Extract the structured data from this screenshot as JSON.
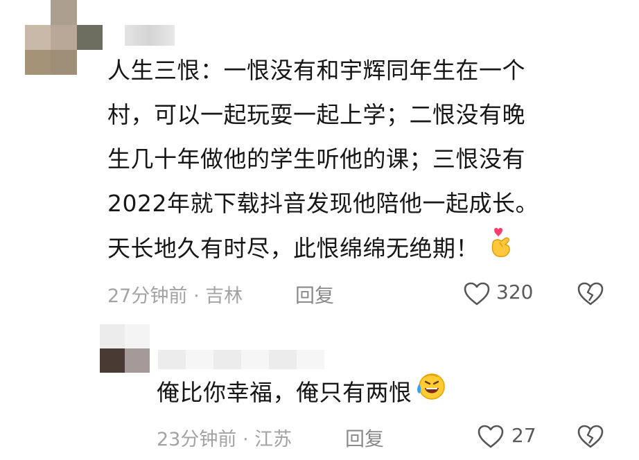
{
  "comments": [
    {
      "lines": [
        "人生三恨：一恨没有和宇辉同年生在一个",
        "村，可以一起玩耍一起上学；二恨没有晚",
        "生几十年做他的学生听他的课；三恨没有",
        "2022年就下载抖音发现他陪他一起成长。",
        "天长地久有时尽，此恨绵绵无绝期！"
      ],
      "emoji": "finger-heart-emoji",
      "time_location": "27分钟前 · 吉林",
      "reply_label": "回复",
      "like_count": "320"
    },
    {
      "text": "俺比你幸福，俺只有两恨",
      "emoji": "laughing-tears-emoji",
      "time_location": "23分钟前 · 江苏",
      "reply_label": "回复",
      "like_count": "27"
    }
  ],
  "icons": {
    "like": "heart-outline-icon",
    "dislike": "broken-heart-icon"
  },
  "colors": {
    "text": "#161616",
    "meta": "#a3a3a3",
    "icon": "#555555"
  }
}
